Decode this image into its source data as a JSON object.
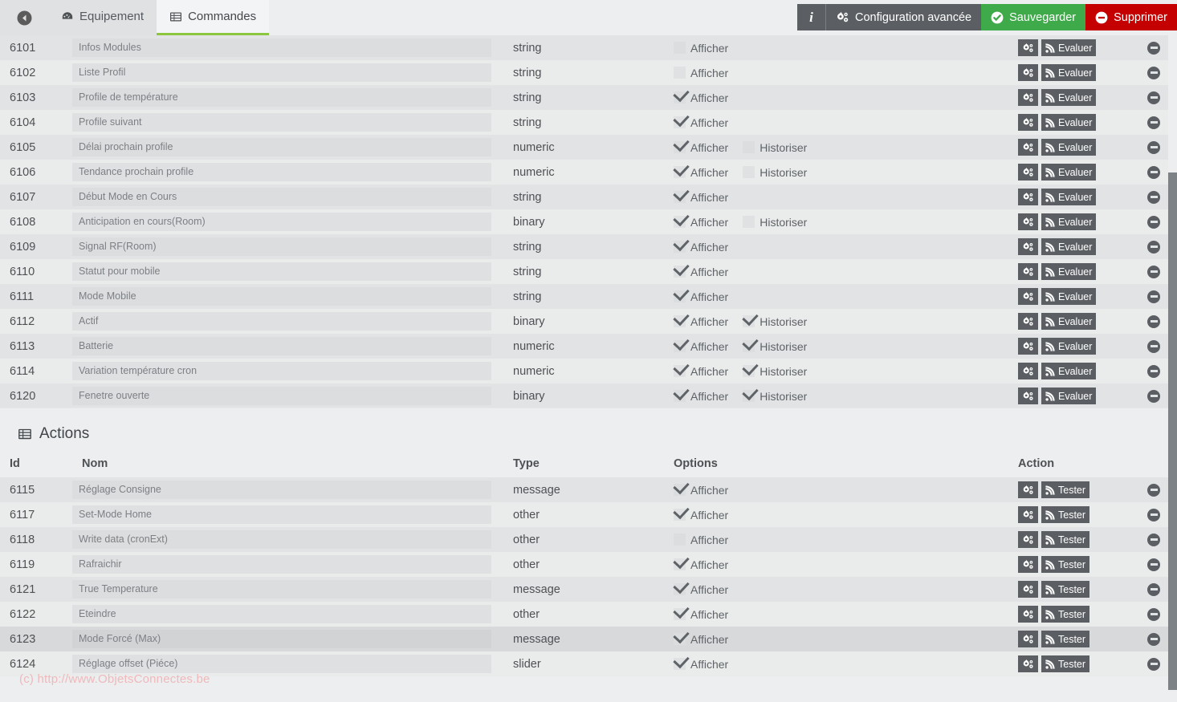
{
  "nav": {
    "back_icon": "arrow-circle-left-icon",
    "tabs": [
      {
        "label": "Equipement",
        "icon": "dashboard-icon",
        "active": false
      },
      {
        "label": "Commandes",
        "icon": "table-icon",
        "active": true
      }
    ]
  },
  "toolbar": {
    "info_label": "i",
    "config_label": "Configuration avancée",
    "config_icon": "cogs-icon",
    "save_label": "Sauvegarder",
    "save_icon": "check-circle-icon",
    "delete_label": "Supprimer",
    "delete_icon": "minus-circle-icon",
    "colors": {
      "neutral": "#5b5f63",
      "save": "#3faa4a",
      "delete": "#c50000"
    }
  },
  "commands_table": {
    "columns": [
      "Id",
      "Nom",
      "Type",
      "Options",
      "Action"
    ],
    "option_labels": {
      "display": "Afficher",
      "history": "Historiser"
    },
    "action_labels": {
      "config": "cogs-icon",
      "eval": "Evaluer"
    },
    "rows": [
      {
        "id": "6101",
        "nom": "Infos Modules",
        "type": "string",
        "afficher": false,
        "historiser": null
      },
      {
        "id": "6102",
        "nom": "Liste Profil",
        "type": "string",
        "afficher": false,
        "historiser": null
      },
      {
        "id": "6103",
        "nom": "Profile de température",
        "type": "string",
        "afficher": true,
        "historiser": null
      },
      {
        "id": "6104",
        "nom": "Profile suivant",
        "type": "string",
        "afficher": true,
        "historiser": null
      },
      {
        "id": "6105",
        "nom": "Délai prochain profile",
        "type": "numeric",
        "afficher": true,
        "historiser": false
      },
      {
        "id": "6106",
        "nom": "Tendance prochain profile",
        "type": "numeric",
        "afficher": true,
        "historiser": false
      },
      {
        "id": "6107",
        "nom": "Début Mode en Cours",
        "type": "string",
        "afficher": true,
        "historiser": null
      },
      {
        "id": "6108",
        "nom": "Anticipation en cours(Room)",
        "type": "binary",
        "afficher": true,
        "historiser": false
      },
      {
        "id": "6109",
        "nom": "Signal RF(Room)",
        "type": "string",
        "afficher": true,
        "historiser": null
      },
      {
        "id": "6110",
        "nom": "Statut pour mobile",
        "type": "string",
        "afficher": true,
        "historiser": null
      },
      {
        "id": "6111",
        "nom": "Mode Mobile",
        "type": "string",
        "afficher": true,
        "historiser": null
      },
      {
        "id": "6112",
        "nom": "Actif",
        "type": "binary",
        "afficher": true,
        "historiser": true
      },
      {
        "id": "6113",
        "nom": "Batterie",
        "type": "numeric",
        "afficher": true,
        "historiser": true
      },
      {
        "id": "6114",
        "nom": "Variation température cron",
        "type": "numeric",
        "afficher": true,
        "historiser": true
      },
      {
        "id": "6120",
        "nom": "Fenetre ouverte",
        "type": "binary",
        "afficher": true,
        "historiser": true
      }
    ]
  },
  "actions_section": {
    "title": "Actions",
    "title_icon": "table-icon",
    "columns": [
      "Id",
      "Nom",
      "Type",
      "Options",
      "Action"
    ],
    "option_labels": {
      "display": "Afficher"
    },
    "action_labels": {
      "config": "cogs-icon",
      "test": "Tester"
    },
    "rows": [
      {
        "id": "6115",
        "nom": "Réglage Consigne",
        "type": "message",
        "afficher": true,
        "hover": false
      },
      {
        "id": "6117",
        "nom": "Set-Mode Home",
        "type": "other",
        "afficher": true,
        "hover": false
      },
      {
        "id": "6118",
        "nom": "Write data (cronExt)",
        "type": "other",
        "afficher": false,
        "hover": false
      },
      {
        "id": "6119",
        "nom": "Rafraichir",
        "type": "other",
        "afficher": true,
        "hover": false
      },
      {
        "id": "6121",
        "nom": "True Temperature",
        "type": "message",
        "afficher": true,
        "hover": false
      },
      {
        "id": "6122",
        "nom": "Eteindre",
        "type": "other",
        "afficher": true,
        "hover": false
      },
      {
        "id": "6123",
        "nom": "Mode Forcé (Max)",
        "type": "message",
        "afficher": true,
        "hover": true
      },
      {
        "id": "6124",
        "nom": "Réglage offset (Piéce)",
        "type": "slider",
        "afficher": true,
        "hover": false
      }
    ]
  },
  "watermark": {
    "text": "(c) http://www.ObjetsConnectes.be",
    "color": "#f0b8bb"
  },
  "scrollbar": {
    "thumb_color": "#7d8287",
    "track_color": "#eceeef"
  }
}
